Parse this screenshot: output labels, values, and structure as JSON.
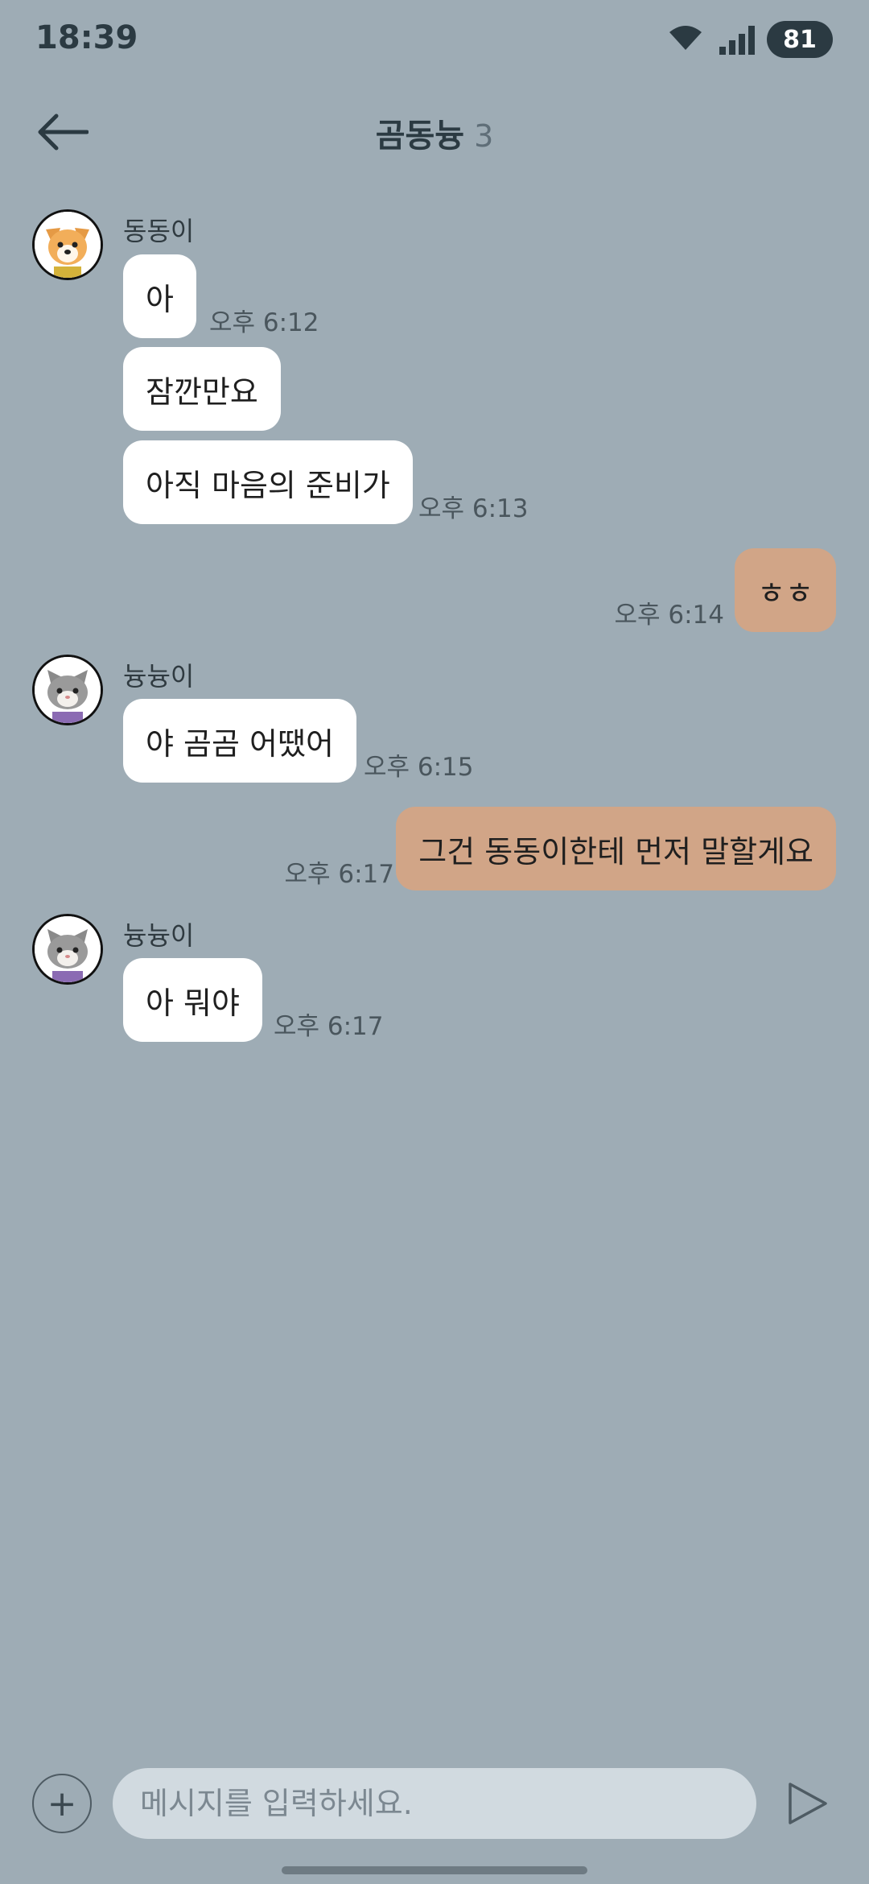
{
  "status_bar": {
    "time": "18:39",
    "battery": "81",
    "icons": [
      "wifi-icon",
      "signal-icon",
      "battery-icon"
    ]
  },
  "header": {
    "back_icon": "arrow-left-icon",
    "title": "곰동늉",
    "member_count": "3"
  },
  "messages": [
    {
      "type": "in",
      "sender": "동동이",
      "avatar": "dog-avatar",
      "text": "아",
      "time": "오후 6:12"
    },
    {
      "type": "in",
      "text": "잠깐만요",
      "time": ""
    },
    {
      "type": "in",
      "text": "아직 마음의 준비가",
      "time": "오후 6:13"
    },
    {
      "type": "out",
      "text": "ㅎㅎ",
      "time": "오후 6:14"
    },
    {
      "type": "in",
      "sender": "늉늉이",
      "avatar": "cat-avatar",
      "text": "야 곰곰 어땠어",
      "time": "오후 6:15"
    },
    {
      "type": "out",
      "text": "그건 동동이한테 먼저 말할게요",
      "time": "오후 6:17"
    },
    {
      "type": "in",
      "sender": "늉늉이",
      "avatar": "cat-avatar",
      "text": "아 뭐야",
      "time": "오후 6:17"
    }
  ],
  "input": {
    "plus_icon": "plus-icon",
    "plus_label": "+",
    "placeholder": "메시지를 입력하세요.",
    "send_icon": "send-icon"
  },
  "colors": {
    "background": "#9eacb5",
    "incoming_bubble": "#ffffff",
    "outgoing_bubble": "#d1a587",
    "input_field": "#d1dae0"
  }
}
